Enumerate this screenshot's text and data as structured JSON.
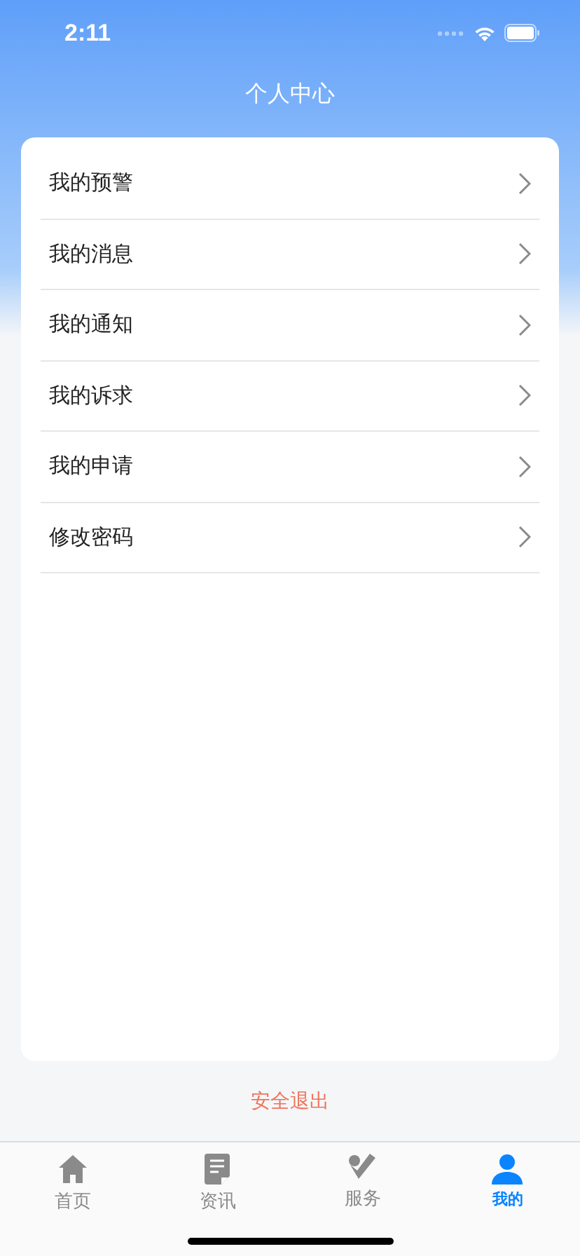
{
  "status_bar": {
    "time": "2:11"
  },
  "header": {
    "title": "个人中心"
  },
  "menu": [
    {
      "label": "我的预警"
    },
    {
      "label": "我的消息"
    },
    {
      "label": "我的通知"
    },
    {
      "label": "我的诉求"
    },
    {
      "label": "我的申请"
    },
    {
      "label": "修改密码"
    }
  ],
  "logout": "安全退出",
  "tabs": [
    {
      "label": "首页",
      "kind": "home",
      "selected": false
    },
    {
      "label": "资讯",
      "kind": "news",
      "selected": false
    },
    {
      "label": "服务",
      "kind": "service",
      "selected": false
    },
    {
      "label": "我的",
      "kind": "profile",
      "selected": true
    }
  ]
}
